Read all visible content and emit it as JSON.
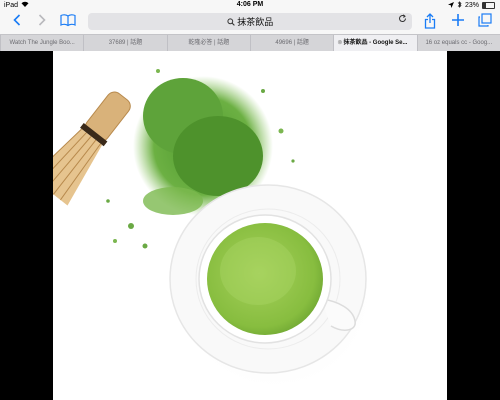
{
  "status_bar": {
    "device": "iPad",
    "time": "4:06 PM",
    "battery": "23%"
  },
  "toolbar": {
    "address": "抹茶飲品"
  },
  "tabs": [
    {
      "label": "Watch The Jungle Boo..."
    },
    {
      "label": "37689 | 話題"
    },
    {
      "label": "乾隆必答 | 話題"
    },
    {
      "label": "49696 | 話題"
    },
    {
      "label": "抹茶飲品 - Google Se...",
      "active": true
    },
    {
      "label": "16 oz equals cc - Goog..."
    }
  ],
  "image": {
    "subject": "matcha-tea-cup-whisk-powder"
  },
  "colors": {
    "accent": "#1a7cf5",
    "matcha": "#8ec64e",
    "powder": "#5ea33a"
  }
}
